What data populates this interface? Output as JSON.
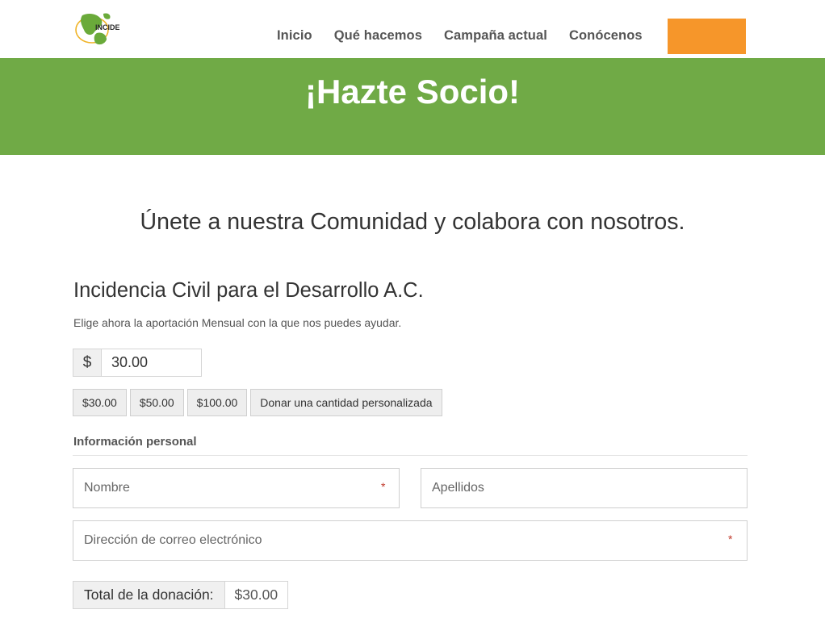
{
  "header": {
    "logo_text": "INCIDE",
    "nav": [
      {
        "label": "Inicio"
      },
      {
        "label": "Qué hacemos"
      },
      {
        "label": "Campaña actual"
      },
      {
        "label": "Conócenos"
      }
    ],
    "cta_label": ""
  },
  "banner": {
    "title": "¡Hazte Socio!"
  },
  "main": {
    "subtitle": "Únete a nuestra Comunidad y colabora con nosotros.",
    "form_title": "Incidencia Civil para el Desarrollo A.C.",
    "form_description": "Elige ahora la aportación Mensual con la que nos puedes ayudar.",
    "amount": {
      "symbol": "$",
      "value": "30.00"
    },
    "levels": [
      {
        "label": "$30.00"
      },
      {
        "label": "$50.00"
      },
      {
        "label": "$100.00"
      },
      {
        "label": "Donar una cantidad personalizada"
      }
    ],
    "section_title": "Información personal",
    "fields": {
      "first_name": {
        "placeholder": "Nombre",
        "required_mark": "*"
      },
      "last_name": {
        "placeholder": "Apellidos"
      },
      "email": {
        "placeholder": "Dirección de correo electrónico",
        "required_mark": "*"
      }
    },
    "total": {
      "label": "Total de la donación:",
      "value": "$30.00"
    }
  },
  "colors": {
    "banner_green": "#70aa46",
    "cta_orange": "#f6962a",
    "required_red": "#c0392b"
  }
}
